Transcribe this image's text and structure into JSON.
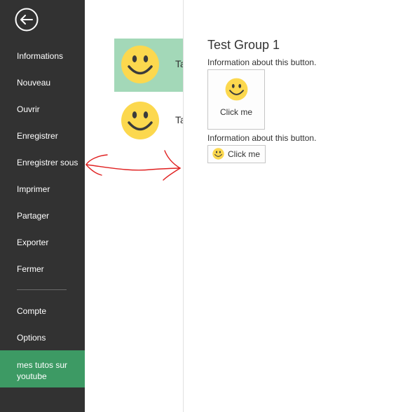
{
  "sidebar": {
    "items": [
      {
        "label": "Informations"
      },
      {
        "label": "Nouveau"
      },
      {
        "label": "Ouvrir"
      },
      {
        "label": "Enregistrer"
      },
      {
        "label": "Enregistrer sous"
      },
      {
        "label": "Imprimer"
      },
      {
        "label": "Partager"
      },
      {
        "label": "Exporter"
      },
      {
        "label": "Fermer"
      },
      {
        "label": "Compte"
      },
      {
        "label": "Options"
      }
    ],
    "special_item": {
      "label": "mes tutos sur youtube",
      "color": "#3d9a64"
    },
    "background": "#323232"
  },
  "tabs": [
    {
      "label": "Ta",
      "selected": true,
      "icon": "smiley-icon"
    },
    {
      "label": "Ta",
      "selected": false,
      "icon": "smiley-icon"
    }
  ],
  "group": {
    "title": "Test Group 1",
    "info_1": "Information about this button.",
    "big_button_label": "Click me",
    "info_2": "Information about this button.",
    "small_button_label": "Click me"
  },
  "colors": {
    "selected_tab": "#a3d8b8",
    "smiley_face": "#fcd84e",
    "annotation": "#e02020"
  }
}
